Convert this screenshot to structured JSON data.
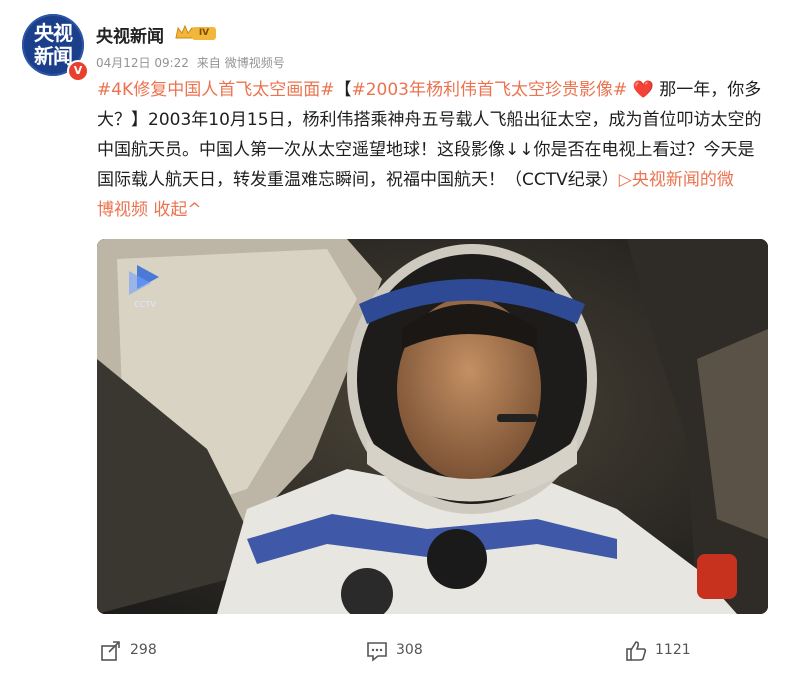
{
  "account": {
    "name": "央视新闻",
    "avatar_lines": [
      "央视",
      "新闻"
    ],
    "verified_mark": "V",
    "level": "IV",
    "date": "04月12日 09:22",
    "source_prefix": "来自",
    "source": "微博视频号"
  },
  "post": {
    "line1_topic1": "#4K修复中国人首飞太空画面#",
    "line1_bracket_open": "【",
    "line1_topic2": "#2003年杨利伟首飞太空珍贵影像#",
    "line1_heart": "❤️",
    "line1_tail": "那一年，你多",
    "line2": "大？】2003年10月15日，杨利伟搭乘神舟五号载人飞船出征太空，成为首位叩访太空的",
    "line3": "中国航天员。中国人第一次从太空遥望地球！这段影像↓↓你是否在电视上看过？今天是",
    "line4_text": "国际载人航天日，转发重温难忘瞬间，祝福中国航天！（CCTV纪录）",
    "line4_link": "▷央视新闻的微",
    "line5_link": "博视频",
    "collapse": "收起^"
  },
  "media": {
    "icons": [
      "play-watermark-icon"
    ],
    "watermark_label": "CCTV"
  },
  "actions": {
    "repost_count": "298",
    "comment_count": "308",
    "like_count": "1121"
  },
  "colors": {
    "accent": "#eb7350",
    "avatar_bg": "#1c3f8c",
    "verified": "#e8402c",
    "badge_gold": "#f2b63a",
    "meta_gray": "#939393"
  }
}
